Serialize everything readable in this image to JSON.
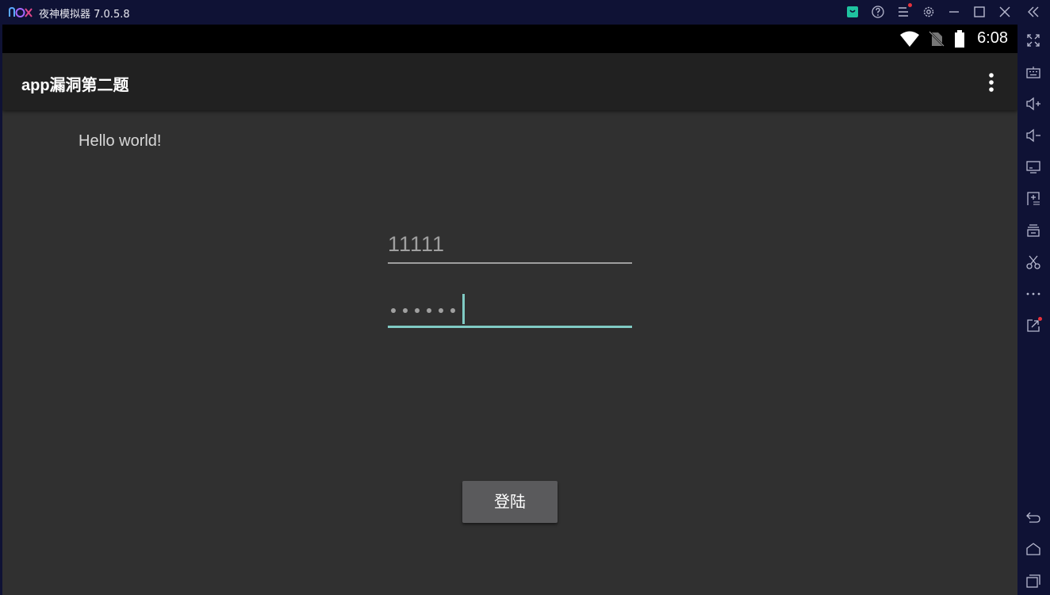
{
  "window": {
    "title": "夜神模拟器 7.0.5.8",
    "logo_text": "nox",
    "controls": [
      "store-icon",
      "help-icon",
      "menu-icon",
      "settings-icon",
      "minimize-icon",
      "maximize-icon",
      "close-icon",
      "collapse-icon"
    ]
  },
  "status_bar": {
    "time": "6:08"
  },
  "app_bar": {
    "title": "app漏洞第二题"
  },
  "content": {
    "hello": "Hello world!",
    "username_value": "11111",
    "password_mask_count": 6,
    "login_label": "登陆"
  },
  "sidebar": {
    "tools": [
      "fullscreen-icon",
      "keyboard-icon",
      "volume-up-icon",
      "volume-down-icon",
      "screen-icon",
      "add-apk-icon",
      "multi-instance-icon",
      "screenshot-cut-icon",
      "more-icon",
      "share-icon"
    ],
    "nav": [
      "back-icon",
      "home-icon",
      "recent-apps-icon"
    ]
  },
  "colors": {
    "accent": "#80cbc4",
    "frame": "#0f1235",
    "screen_bg": "#303030",
    "appbar_bg": "#212121"
  }
}
